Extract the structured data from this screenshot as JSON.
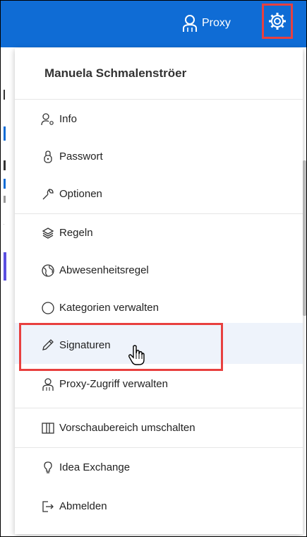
{
  "topbar": {
    "proxy_label": "Proxy"
  },
  "menu": {
    "user_name": "Manuela Schmalenströer",
    "items": [
      {
        "label": "Info",
        "icon": "user-gear-icon"
      },
      {
        "label": "Passwort",
        "icon": "lock-icon"
      },
      {
        "label": "Optionen",
        "icon": "wrench-icon"
      },
      {
        "label": "Regeln",
        "icon": "layers-icon"
      },
      {
        "label": "Abwesenheitsregel",
        "icon": "globe-icon"
      },
      {
        "label": "Kategorien verwalten",
        "icon": "circle-icon"
      },
      {
        "label": "Signaturen",
        "icon": "pencil-icon"
      },
      {
        "label": "Proxy-Zugriff verwalten",
        "icon": "proxy-user-icon"
      },
      {
        "label": "Vorschaubereich umschalten",
        "icon": "panel-icon"
      },
      {
        "label": "Idea Exchange",
        "icon": "lightbulb-icon"
      },
      {
        "label": "Abmelden",
        "icon": "logout-icon"
      }
    ]
  },
  "colors": {
    "accent": "#0f6cd5",
    "highlight_border": "#e8403f",
    "hover_bg": "#eef3fb"
  }
}
